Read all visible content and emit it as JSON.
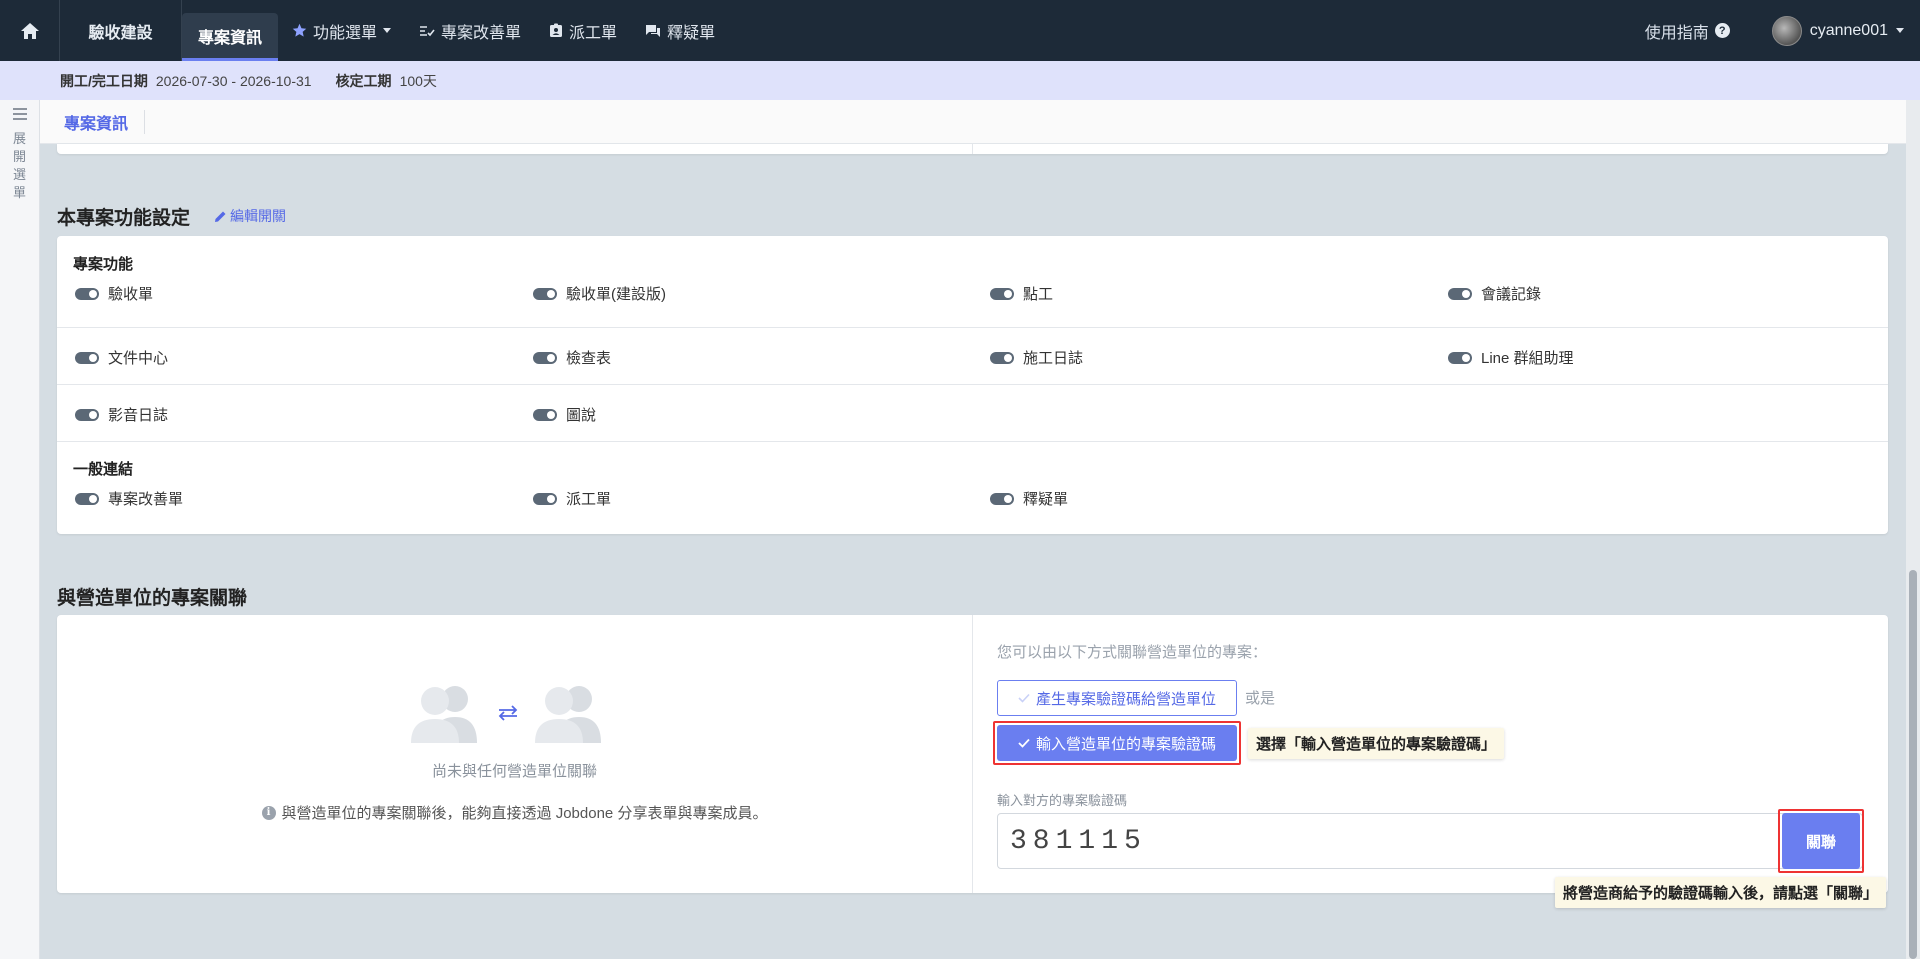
{
  "nav": {
    "brand": "驗收建設",
    "items": [
      {
        "label": "專案資訊"
      },
      {
        "label": "功能選單"
      },
      {
        "label": "專案改善單"
      },
      {
        "label": "派工單"
      },
      {
        "label": "釋疑單"
      }
    ],
    "guide": "使用指南",
    "user": "cyanne001"
  },
  "info_bar": {
    "date_label": "開工/完工日期",
    "date_value": "2026-07-30 - 2026-10-31",
    "duration_label": "核定工期",
    "duration_value": "100天"
  },
  "left_rail": {
    "label": "展開選單"
  },
  "subheader": {
    "tab": "專案資訊"
  },
  "features": {
    "title": "本專案功能設定",
    "edit_label": "編輯開關",
    "group1_label": "專案功能",
    "group1": [
      "驗收單",
      "驗收單(建設版)",
      "點工",
      "會議記錄",
      "文件中心",
      "檢查表",
      "施工日誌",
      "Line 群組助理",
      "影音日誌",
      "圖說"
    ],
    "group2_label": "一般連結",
    "group2": [
      "專案改善單",
      "派工單",
      "釋疑單"
    ]
  },
  "association": {
    "title": "與營造單位的專案關聯",
    "empty_text": "尚未與任何營造單位關聯",
    "note": "與營造單位的專案關聯後，能夠直接透過 Jobdone 分享表單與專案成員。",
    "hint": "您可以由以下方式關聯營造單位的專案：",
    "generate_btn": "產生專案驗證碼給營造單位",
    "or_text": "或是",
    "enter_btn": "輸入營造單位的專案驗證碼",
    "tooltip_select": "選擇「輸入營造單位的專案驗證碼」",
    "code_label": "輸入對方的專案驗證碼",
    "code_value": "381115",
    "link_btn": "關聯",
    "tooltip_link": "將營造商給予的驗證碼輸入後，請點選「關聯」"
  },
  "colors": {
    "nav_bg": "#1d2a38",
    "accent": "#6a7ef0",
    "info_bar_bg": "#dfe2fb",
    "highlight_border": "#e33333",
    "tooltip_bg": "#fcf8e6"
  }
}
